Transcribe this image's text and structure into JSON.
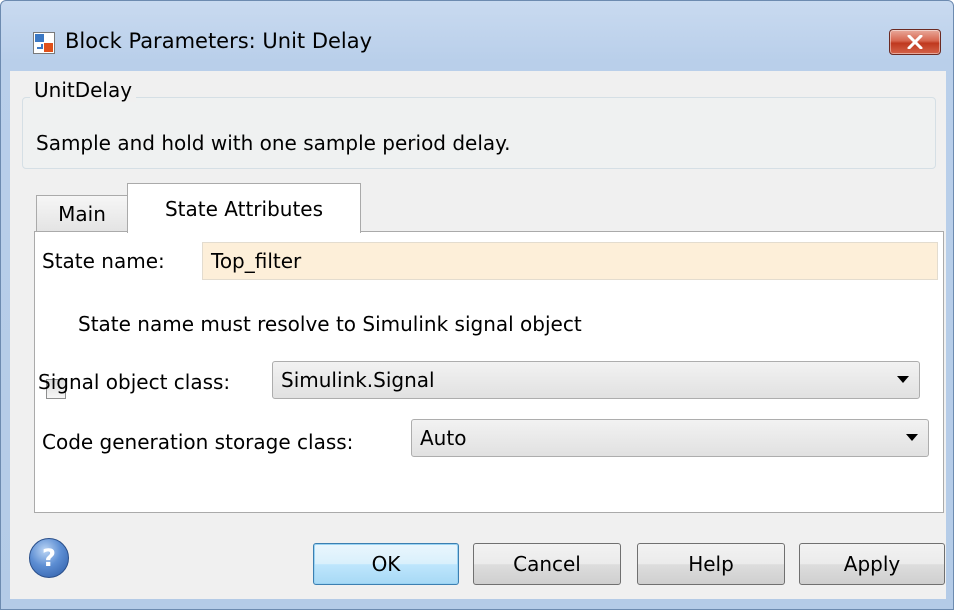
{
  "window": {
    "title": "Block Parameters: Unit Delay"
  },
  "block": {
    "type": "UnitDelay",
    "description": "Sample and hold with one sample period delay."
  },
  "tabs": [
    {
      "label": "Main",
      "active": false
    },
    {
      "label": "State Attributes",
      "active": true
    }
  ],
  "state_attributes": {
    "state_name_label": "State name:",
    "state_name_value": "Top_filter",
    "resolve_checkbox_label": "State name must resolve to Simulink signal object",
    "resolve_checked": false,
    "signal_class_label": "Signal object class:",
    "signal_class_value": "Simulink.Signal",
    "storage_class_label": "Code generation storage class:",
    "storage_class_value": "Auto"
  },
  "buttons": {
    "ok": "OK",
    "cancel": "Cancel",
    "help": "Help",
    "apply": "Apply"
  },
  "icons": {
    "app": "simulink-block-icon",
    "close": "close-icon",
    "help": "help-icon"
  },
  "colors": {
    "title_bar": "#b9cfea",
    "close_button": "#c0391f",
    "state_name_field": "#fdefd9",
    "default_button": "#bee6fd"
  }
}
